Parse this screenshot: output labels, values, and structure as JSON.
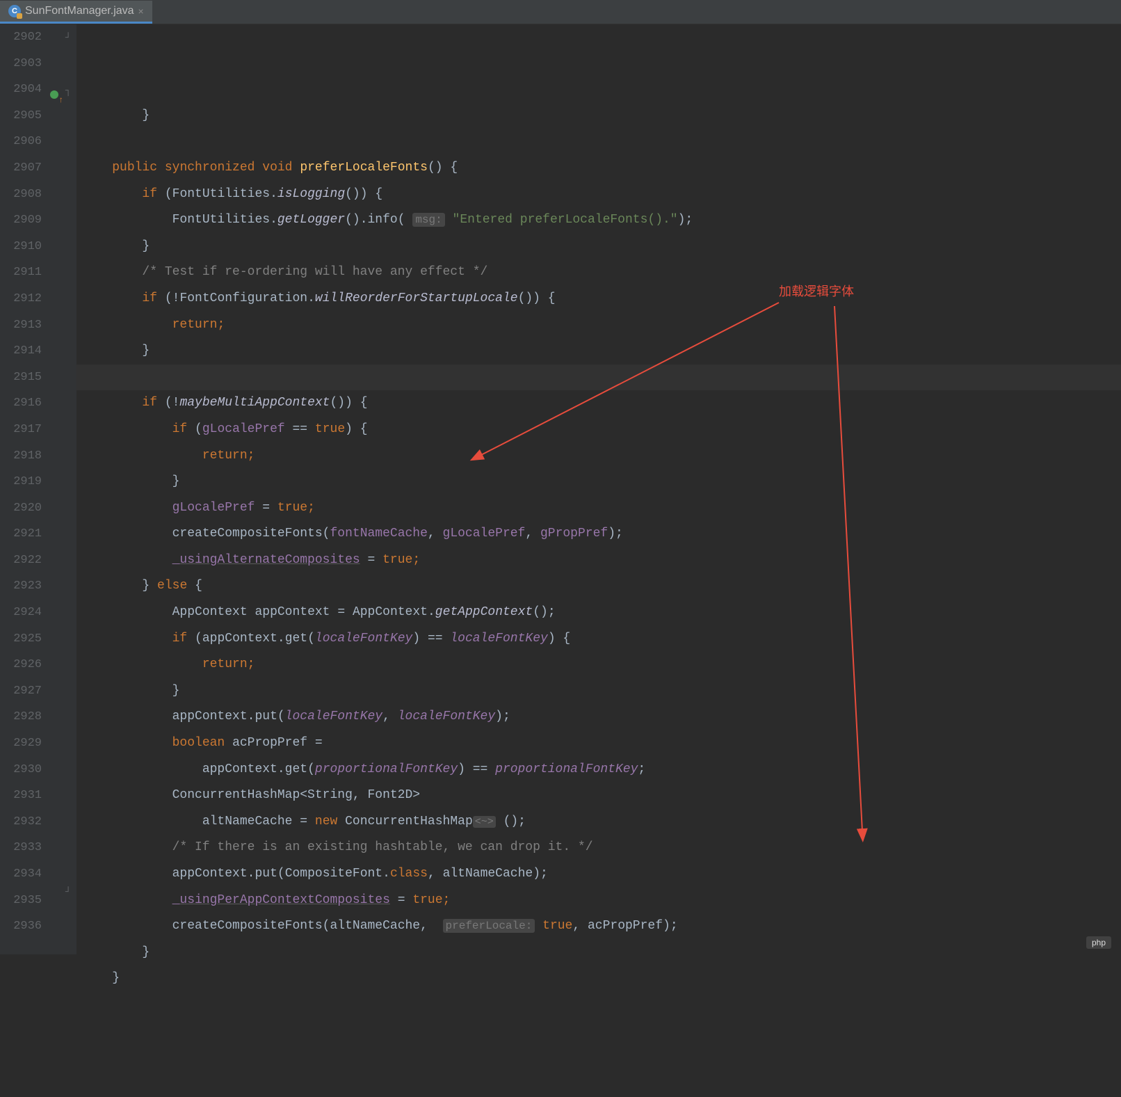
{
  "tab": {
    "filename": "SunFontManager.java"
  },
  "gutter": {
    "start": 2902,
    "end": 2936
  },
  "annotation": {
    "label": "加载逻辑字体"
  },
  "code": {
    "l02": "        }",
    "l04_pub": "public",
    "l04_sync": "synchronized",
    "l04_void": "void",
    "l04_name": "preferLocaleFonts",
    "l05_if": "if",
    "l05_class": "FontUtilities",
    "l05_log": "isLogging",
    "l06_class": "FontUtilities",
    "l06_get": "getLogger",
    "l06_info": "info",
    "l06_hint": "msg:",
    "l06_str": "\"Entered preferLocaleFonts().\"",
    "l08_comment": "/* Test if re-ordering will have any effect */",
    "l09_if": "if",
    "l09_class": "FontConfiguration",
    "l09_m": "willReorderForStartupLocale",
    "l10_ret": "return",
    "l13_if": "if",
    "l13_m": "maybeMultiAppContext",
    "l14_if": "if",
    "l14_f": "gLocalePref",
    "l14_true": "true",
    "l15_ret": "return",
    "l17_f": "gLocalePref",
    "l17_true": "true",
    "l18_m": "createCompositeFonts",
    "l18_a1": "fontNameCache",
    "l18_a2": "gLocalePref",
    "l18_a3": "gPropPref",
    "l19_f": "_usingAlternateComposites",
    "l19_true": "true",
    "l20_else": "else",
    "l21_cls": "AppContext",
    "l21_var": "appContext",
    "l21_cls2": "AppContext",
    "l21_m": "getAppContext",
    "l22_if": "if",
    "l22_var": "appContext",
    "l22_get": "get",
    "l22_k": "localeFontKey",
    "l22_k2": "localeFontKey",
    "l23_ret": "return",
    "l25_var": "appContext",
    "l25_put": "put",
    "l25_k": "localeFontKey",
    "l25_k2": "localeFontKey",
    "l26_bool": "boolean",
    "l26_var": "acPropPref",
    "l27_var": "appContext",
    "l27_get": "get",
    "l27_k": "proportionalFontKey",
    "l27_k2": "proportionalFontKey",
    "l28_c": "ConcurrentHashMap<String, Font2D>",
    "l29_var": "altNameCache",
    "l29_new": "new",
    "l29_c": "ConcurrentHashMap",
    "l29_hint": "<~>",
    "l30_comment": "/* If there is an existing hashtable, we can drop it. */",
    "l31_var": "appContext",
    "l31_put": "put",
    "l31_a1": "CompositeFont",
    "l31_cls": "class",
    "l31_a2": "altNameCache",
    "l32_f": "_usingPerAppContextComposites",
    "l32_true": "true",
    "l33_m": "createCompositeFonts",
    "l33_a1": "altNameCache",
    "l33_hint": "preferLocale:",
    "l33_true": "true",
    "l33_a2": "acPropPref"
  },
  "watermark": "php"
}
